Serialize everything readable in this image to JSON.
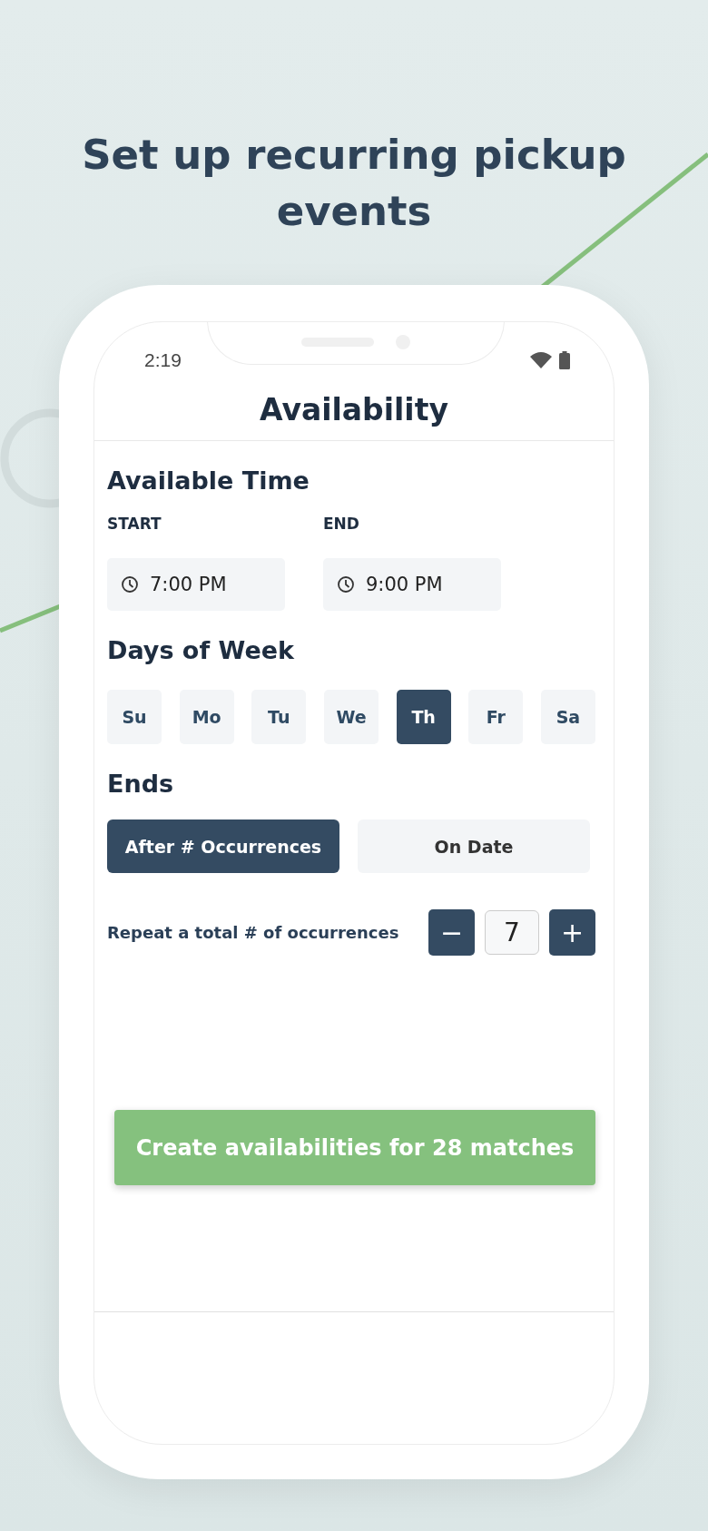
{
  "headline": "Set up recurring pickup events",
  "status_bar": {
    "time": "2:19"
  },
  "header": {
    "title": "Availability"
  },
  "available_time": {
    "title": "Available Time",
    "fields": [
      {
        "label": "START",
        "value": "7:00 PM"
      },
      {
        "label": "END",
        "value": "9:00 PM"
      }
    ]
  },
  "days_of_week": {
    "title": "Days of Week",
    "days": [
      {
        "label": "Su",
        "selected": false
      },
      {
        "label": "Mo",
        "selected": false
      },
      {
        "label": "Tu",
        "selected": false
      },
      {
        "label": "We",
        "selected": false
      },
      {
        "label": "Th",
        "selected": true
      },
      {
        "label": "Fr",
        "selected": false
      },
      {
        "label": "Sa",
        "selected": false
      }
    ]
  },
  "ends": {
    "title": "Ends",
    "options": [
      {
        "label": "After # Occurrences",
        "selected": true
      },
      {
        "label": "On Date",
        "selected": false
      }
    ]
  },
  "repeat": {
    "label": "Repeat a total # of occurrences",
    "decrement": "−",
    "value": "7",
    "increment": "+"
  },
  "create_button": "Create availabilities for 28 matches"
}
